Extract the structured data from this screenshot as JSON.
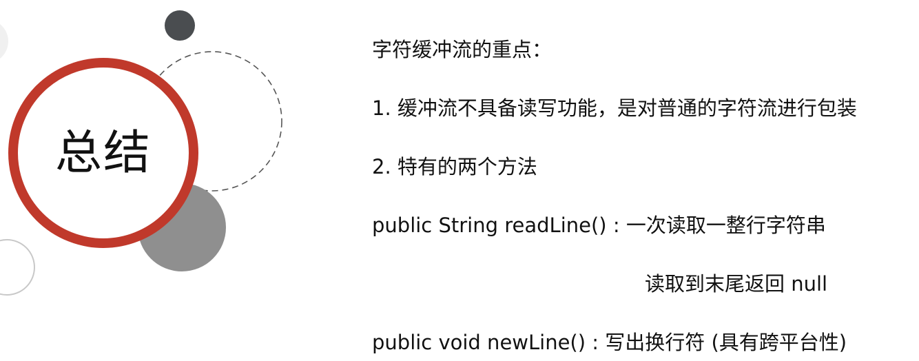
{
  "title": "总结",
  "heading": "字符缓冲流的重点：",
  "points": [
    "1.  缓冲流不具备读写功能，是对普通的字符流进行包装",
    "2.  特有的两个方法"
  ],
  "methods": [
    {
      "signature": "public String readLine() : 一次读取一整行字符串",
      "note": "读取到末尾返回 null"
    },
    {
      "signature": "public void newLine() : 写出换行符 (具有跨平台性)"
    }
  ],
  "colors": {
    "accent_ring": "#c0392b",
    "dark_dot": "#4a4d50",
    "gray_circle": "#8f8f8f",
    "dashed_circle": "#555555",
    "outline_circle": "#c8c8c8"
  }
}
